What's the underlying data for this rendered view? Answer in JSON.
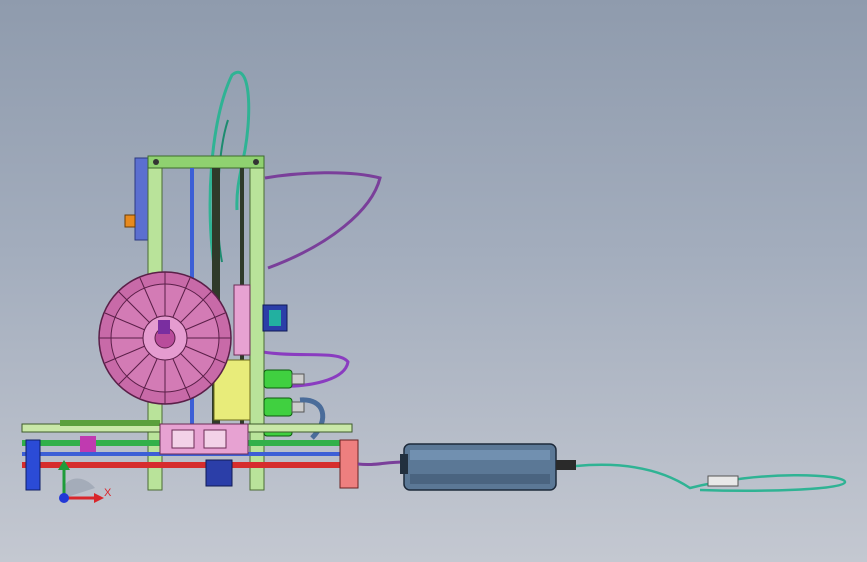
{
  "viewport": {
    "background_top": "#8f9bad",
    "background_bottom": "#c4c8d1"
  },
  "model": {
    "frame_color": "#9ad07a",
    "spool_color": "#c86aa8",
    "filament_color": "#2fb394",
    "tube_color": "#7a3f9a",
    "rail_color": "#d62d2d",
    "power_supply_color": "#5b7896"
  },
  "triad": {
    "x_label": "X",
    "x_color": "#d9262b",
    "y_color": "#1e9c3a",
    "z_color": "#2238d6",
    "icon": "coordinate-triad-icon"
  }
}
